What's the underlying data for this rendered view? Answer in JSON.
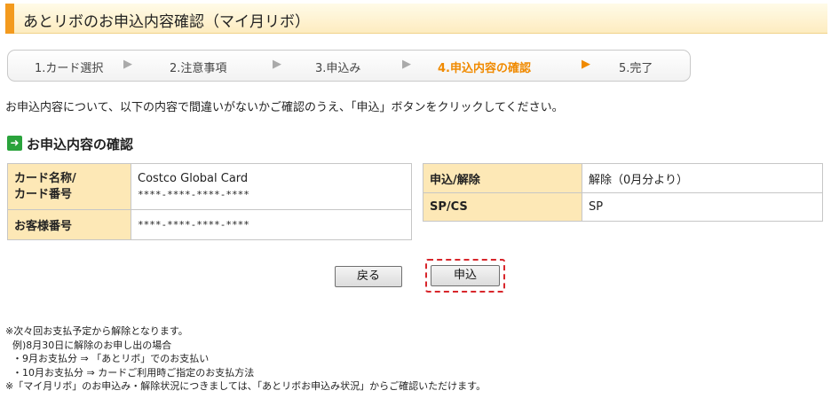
{
  "page": {
    "title": "あとリボのお申込内容確認（マイ月リボ）",
    "description": "お申込内容について、以下の内容で間違いがないかご確認のうえ、「申込」ボタンをクリックしてください。"
  },
  "steps": [
    {
      "label": "1.カード選択",
      "current": false
    },
    {
      "label": "2.注意事項",
      "current": false
    },
    {
      "label": "3.申込み",
      "current": false
    },
    {
      "label": "4.申込内容の確認",
      "current": true
    },
    {
      "label": "5.完了",
      "current": false
    }
  ],
  "step_arrow": "▶",
  "section": {
    "icon": "arrow-right-icon",
    "heading": "お申込内容の確認"
  },
  "card_table": {
    "card_label": "カード名称/カード番号",
    "card_label_line1": "カード名称/",
    "card_label_line2": "カード番号",
    "card_name": "Costco Global Card",
    "card_number": "****-****-****-****",
    "customer_label": "お客様番号",
    "customer_number": "****-****-****-****"
  },
  "apply_table": {
    "apply_label": "申込/解除",
    "apply_value": "解除（0月分より）",
    "spcs_label": "SP/CS",
    "spcs_value": "SP"
  },
  "buttons": {
    "back": "戻る",
    "apply": "申込"
  },
  "notes": [
    "※次々回お支払予定から解除となります。",
    "例)8月30日に解除のお申し出の場合",
    "・9月お支払分 ⇒ 「あとリボ」でのお支払い",
    "・10月お支払分 ⇒ カードご利用時ご指定のお支払方法",
    "※「マイ月リボ」のお申込み・解除状況につきましては、「あとリボお申込み状況」からご確認いただけます。"
  ],
  "colors": {
    "accent": "#f39a1e",
    "current_step": "#f08a00",
    "header_cell": "#fde8b6",
    "highlight_border": "#d8262b",
    "section_icon": "#2aa33c"
  }
}
